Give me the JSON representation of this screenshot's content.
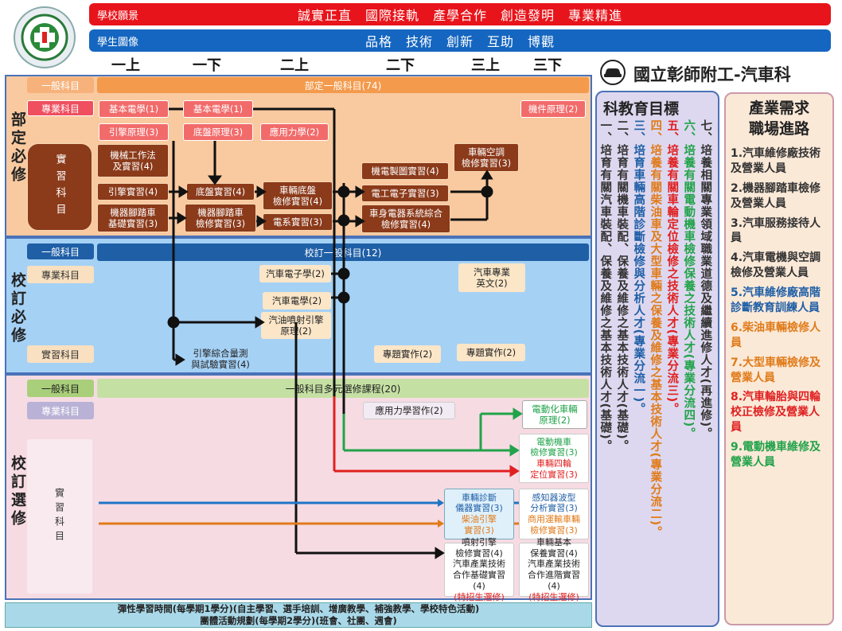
{
  "header": {
    "vision_label": "學校願景",
    "vision_text": "誠實正直　國際接軌　產學合作　創造發明　專業精進",
    "portrait_label": "學生圖像",
    "portrait_text": "品格　技術　創新　互助　博觀"
  },
  "semesters": [
    "一上",
    "一下",
    "二上",
    "二下",
    "三上",
    "三下"
  ],
  "school_title": "國立彰師附工-汽車科",
  "sections": {
    "dept": {
      "title": "部定必修"
    },
    "school": {
      "title": "校訂必修"
    },
    "elective": {
      "title": "校訂選修"
    }
  },
  "dept": {
    "general_label": "一般科目",
    "general_bar": "部定一般科目(74)",
    "prof_label": "專業科目",
    "practice_label": "實習科目",
    "courses": {
      "basic_elec_1": "基本電學(1)",
      "basic_elec_2": "基本電學(1)",
      "machine_parts": "機件原理(2)",
      "engine_principle": "引擎原理(3)",
      "chassis_principle": "底盤原理(3)",
      "applied_mech": "應用力學(2)",
      "mech_work": "機械工作法\n及實習(4)",
      "engine_practice": "引擎實習(4)",
      "chassis_practice": "底盤實習(4)",
      "vehicle_chassis": "車輛底盤\n檢修實習(4)",
      "moto_basic": "機器腳踏車\n基礎實習(3)",
      "moto_repair": "機器腳踏車\n檢修實習(3)",
      "elec_system": "電系實習(3)",
      "mechatronics": "機電製圖實習(4)",
      "electronics": "電工電子實習(3)",
      "body_elec": "車身電器系統綜合\n檢修實習(4)",
      "ac_repair": "車輛空調\n檢修實習(3)"
    }
  },
  "school": {
    "general_label": "一般科目",
    "general_bar": "校訂一般科目(12)",
    "prof_label": "專業科目",
    "practice_label": "實習科目",
    "courses": {
      "car_electronics": "汽車電子學(2)",
      "car_electric": "汽車電學(2)",
      "fuel_injection": "汽油噴射引擎\n原理(2)",
      "english": "汽車專業\n英文(2)",
      "engine_test": "引擎綜合量測\n與試驗實習(4)",
      "project_1": "專題實作(2)",
      "project_2": "專題實作(2)"
    }
  },
  "elective": {
    "general_label": "一般科目",
    "general_bar": "一般科目多元選修課程(20)",
    "prof_label": "專業科目",
    "practice_label": "實習科目",
    "courses": {
      "applied_mech_practice": "應用力學習作(2)",
      "ev_principle": "電動化車輛\n原理(2)",
      "ev_motor": "電動機車\n檢修實習(3)",
      "wheel_align": "車輛四輪\n定位實習(3)",
      "diag_inst": "車輛診斷\n儀器實習(3)",
      "diesel": "柴油引擎\n實習(3)",
      "sensor_wave": "感知器波型\n分析實習(3)",
      "commercial": "商用運輸車輛\n檢修實習(3)",
      "injection_engine": "噴射引擎\n檢修實習(4)",
      "coop_basic": "汽車產業技術\n合作基礎實習(4)",
      "special_1": "(特招生選修)",
      "basic_maint": "車輛基本\n保養實習(4)",
      "coop_advanced": "汽車產業技術\n合作進階實習(4)",
      "special_2": "(特招生選修)"
    }
  },
  "footer": {
    "line1": "彈性學習時間(每學期1學分)(自主學習、選手培訓、增廣教學、補強教學、學校特色活動)",
    "line2": "團體活動規劃(每學期2學分)(班會、社團、週會)"
  },
  "goals": {
    "title": "科教育目標",
    "items": [
      {
        "text": "一、培育有關汽車裝配、保養及維修之基本技術人才(基礎)。",
        "color": "#333333"
      },
      {
        "text": "二、培育有關機車裝配、保養及維修之基本技術人才(基礎)。",
        "color": "#333333"
      },
      {
        "text": "三、培育車輛高階診斷檢修與分析人才(專業分流一)。",
        "color": "#1f5fa6"
      },
      {
        "text": "四、培養有關柴油車及大型車輛之保養及維修之基本技術人才(專業分流二)。",
        "color": "#e07b1a"
      },
      {
        "text": "五、培養有關車輪定位檢修之技術人才(專業分流三)。",
        "color": "#e02020"
      },
      {
        "text": "六、培養有關電動機車檢修保養之技術人才(專業分流四)。",
        "color": "#22a34a"
      },
      {
        "text": "七、培養相關專業領域職業道德及繼續進修人才(再進修)。",
        "color": "#333333"
      }
    ]
  },
  "careers": {
    "title": "產業需求\n職場進路",
    "items": [
      {
        "text": "1.汽車維修廠技術及營業人員",
        "color": "#333333"
      },
      {
        "text": "2.機器腳踏車檢修及營業人員",
        "color": "#333333"
      },
      {
        "text": "3.汽車服務接待人員",
        "color": "#333333"
      },
      {
        "text": "4.汽車電機與空調檢修及營業人員",
        "color": "#333333"
      },
      {
        "text": "5.汽車維修廠高階診斷教育訓練人員",
        "color": "#1f5fa6"
      },
      {
        "text": "6.柴油車輛檢修人員",
        "color": "#e07b1a"
      },
      {
        "text": "7.大型車輛檢修及營業人員",
        "color": "#e07b1a"
      },
      {
        "text": "8.汽車輪胎與四輪校正檢修及營業人員",
        "color": "#e02020"
      },
      {
        "text": "9.電動機車維修及營業人員",
        "color": "#22a34a"
      }
    ]
  }
}
